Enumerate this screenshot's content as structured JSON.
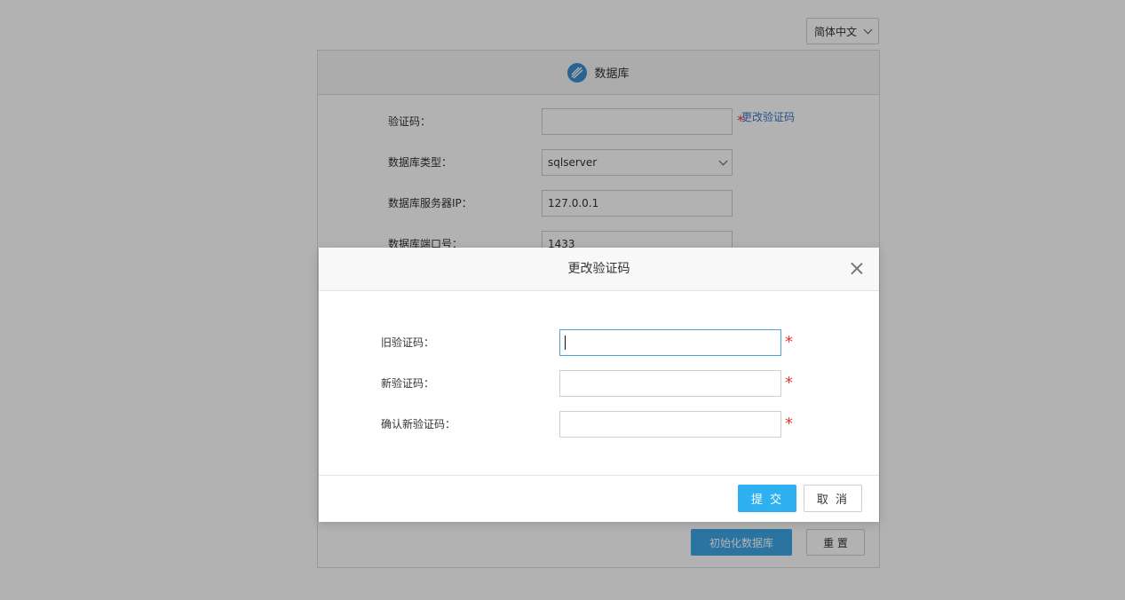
{
  "language": {
    "selected": "简体中文"
  },
  "panel": {
    "title": "数据库",
    "fields": [
      {
        "label": "验证码：",
        "value": ""
      },
      {
        "label": "数据库类型：",
        "value": "sqlserver"
      },
      {
        "label": "数据库服务器IP：",
        "value": "127.0.0.1"
      },
      {
        "label": "数据库端口号：",
        "value": "1433"
      }
    ],
    "change_code_link": "更改验证码",
    "required_mark": "*",
    "init_button": "初始化数据库",
    "reset_button": "重 置"
  },
  "modal": {
    "title": "更改验证码",
    "fields": [
      {
        "label": "旧验证码：",
        "value": ""
      },
      {
        "label": "新验证码：",
        "value": ""
      },
      {
        "label": "确认新验证码：",
        "value": ""
      }
    ],
    "required_mark": "*",
    "submit_button": "提 交",
    "cancel_button": "取 消"
  },
  "colors": {
    "primary": "#2fb0f0",
    "required": "#e53935",
    "link": "#3b78c6"
  },
  "icons": {
    "database": "database-logo-icon",
    "dropdown": "chevron-down-icon",
    "close": "close-icon"
  }
}
